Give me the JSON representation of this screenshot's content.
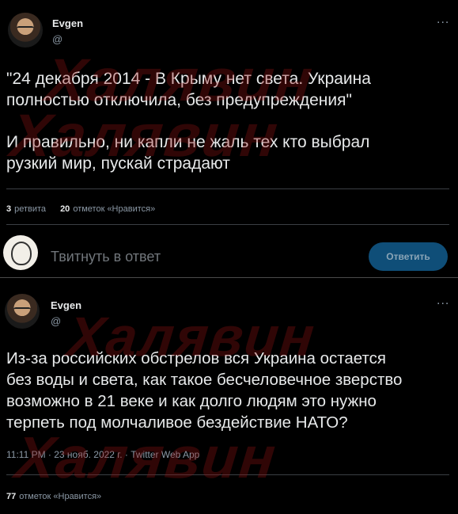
{
  "tweet1": {
    "name": "Evgen",
    "handle": "@",
    "more": "...",
    "text_line1": "\"24 декабря 2014 - В Крыму нет света. Украина",
    "text_line2": "полностью отключила, без предупреждения\"",
    "text_line3": "И правильно, ни капли не жаль тех кто выбрал",
    "text_line4": "рузкий мир, пускай страдают",
    "retweets_count": "3",
    "retweets_label": "ретвита",
    "likes_count": "20",
    "likes_label": "отметок «Нравится»"
  },
  "reply": {
    "placeholder": "Твитнуть в ответ",
    "button": "Ответить"
  },
  "tweet2": {
    "name": "Evgen",
    "handle": "@",
    "more": "...",
    "text_line1": "Из-за российских обстрелов вся Украина остается",
    "text_line2": "без воды и света, как такое бесчеловечное зверство",
    "text_line3": "возможно в 21 веке и как долго людям это нужно",
    "text_line4": "терпеть под молчаливое бездействие НАТО?",
    "meta": "11:11 PM · 23 нояб. 2022 г. · Twitter Web App",
    "likes_count": "77",
    "likes_label": "отметок «Нравится»"
  },
  "watermark": "Халявин",
  "colors": {
    "background": "#000000",
    "text": "#e7e9ea",
    "secondary": "#8b98a5",
    "button": "#0f4e78",
    "watermark": "#961414"
  }
}
